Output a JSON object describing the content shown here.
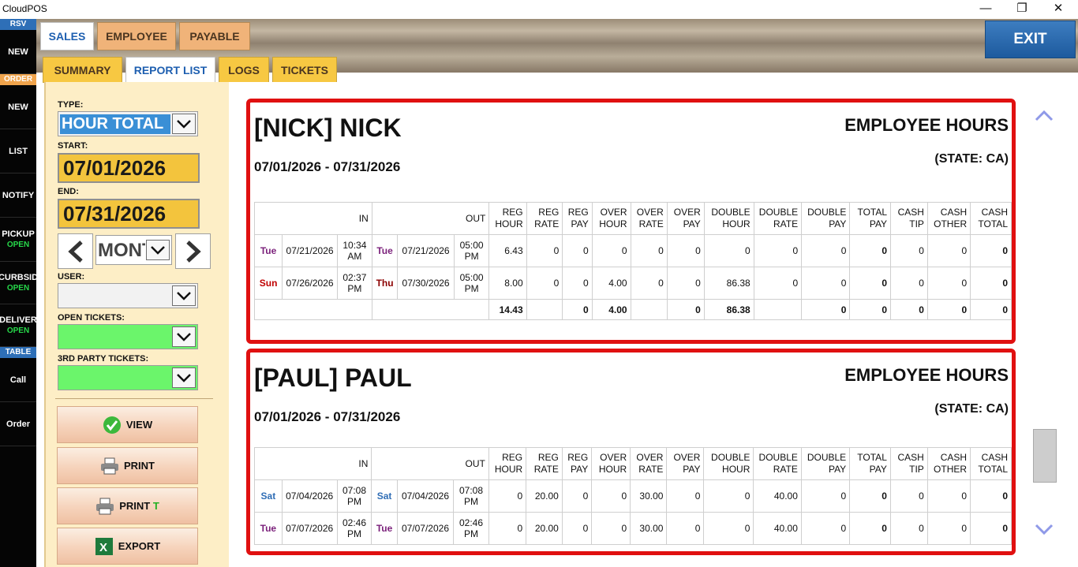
{
  "window": {
    "title": "CloudPOS",
    "min": "—",
    "max": "❐",
    "close": "✕"
  },
  "sidebar": {
    "rsv_label": "RSV",
    "new1": "NEW",
    "order_label": "ORDER",
    "new2": "NEW",
    "list": "LIST",
    "notify": "NOTIFY",
    "pickup": "PICKUP",
    "pickup_status": "OPEN",
    "curbside": "CURBSID",
    "curbside_status": "OPEN",
    "delivery": "DELIVER",
    "delivery_status": "OPEN",
    "table_label": "TABLE",
    "call": "Call",
    "order": "Order"
  },
  "top_tabs": [
    "SALES",
    "EMPLOYEE",
    "PAYABLE"
  ],
  "sub_tabs": [
    "SUMMARY",
    "REPORT LIST",
    "LOGS",
    "TICKETS"
  ],
  "exit_label": "EXIT",
  "filters": {
    "type_label": "TYPE:",
    "type_value": "HOUR TOTAL",
    "start_label": "START:",
    "start_value": "07/01/2026",
    "end_label": "END:",
    "end_value": "07/31/2026",
    "period_value": "MONTH",
    "user_label": "USER:",
    "user_value": "",
    "open_tickets_label": "OPEN TICKETS:",
    "open_tickets_value": "",
    "third_party_label": "3RD PARTY TICKETS:",
    "third_party_value": ""
  },
  "actions": {
    "view": "VIEW",
    "print": "PRINT",
    "print_t_prefix": "PRINT ",
    "print_t_suffix": "T",
    "export": "EXPORT"
  },
  "report": {
    "header": [
      "IN",
      "OUT",
      "REG HOUR",
      "REG RATE",
      "REG PAY",
      "OVER HOUR",
      "OVER RATE",
      "OVER PAY",
      "DOUBLE HOUR",
      "DOUBLE RATE",
      "DOUBLE PAY",
      "TOTAL PAY",
      "CASH TIP",
      "CASH OTHER",
      "CASH TOTAL"
    ],
    "cards": [
      {
        "name": "[NICK] NICK",
        "title": "EMPLOYEE HOURS",
        "date_range": "07/01/2026 - 07/31/2026",
        "state": "(STATE: CA)",
        "rows": [
          {
            "in_day": "Tue",
            "in_date": "07/21/2026",
            "in_time": "10:34 AM",
            "out_day": "Tue",
            "out_date": "07/21/2026",
            "out_time": "05:00 PM",
            "vals": [
              "6.43",
              "0",
              "0",
              "0",
              "0",
              "0",
              "0",
              "0",
              "0",
              "0",
              "0",
              "0",
              "0"
            ]
          },
          {
            "in_day": "Sun",
            "in_date": "07/26/2026",
            "in_time": "02:37 PM",
            "out_day": "Thu",
            "out_date": "07/30/2026",
            "out_time": "05:00 PM",
            "vals": [
              "8.00",
              "0",
              "0",
              "4.00",
              "0",
              "0",
              "86.38",
              "0",
              "0",
              "0",
              "0",
              "0",
              "0"
            ]
          }
        ],
        "totals": [
          "14.43",
          "",
          "0",
          "4.00",
          "",
          "0",
          "86.38",
          "",
          "0",
          "0",
          "0",
          "0",
          "0"
        ]
      },
      {
        "name": "[PAUL] PAUL",
        "title": "EMPLOYEE HOURS",
        "date_range": "07/01/2026 - 07/31/2026",
        "state": "(STATE: CA)",
        "rows": [
          {
            "in_day": "Sat",
            "in_date": "07/04/2026",
            "in_time": "07:08 PM",
            "out_day": "Sat",
            "out_date": "07/04/2026",
            "out_time": "07:08 PM",
            "vals": [
              "0",
              "20.00",
              "0",
              "0",
              "30.00",
              "0",
              "0",
              "40.00",
              "0",
              "0",
              "0",
              "0",
              "0"
            ]
          },
          {
            "in_day": "Tue",
            "in_date": "07/07/2026",
            "in_time": "02:46 PM",
            "out_day": "Tue",
            "out_date": "07/07/2026",
            "out_time": "02:46 PM",
            "vals": [
              "0",
              "20.00",
              "0",
              "0",
              "30.00",
              "0",
              "0",
              "40.00",
              "0",
              "0",
              "0",
              "0",
              "0"
            ]
          }
        ],
        "totals": []
      }
    ]
  }
}
